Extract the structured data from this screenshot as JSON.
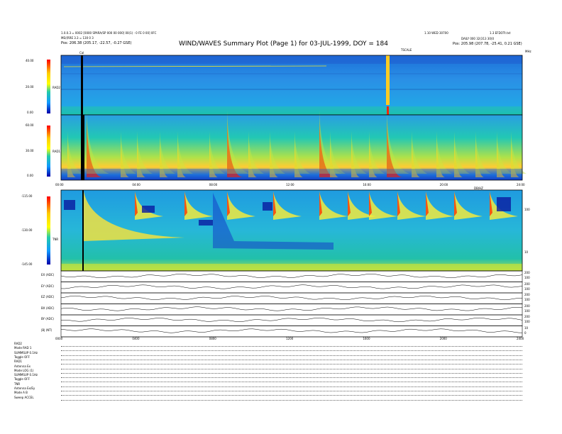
{
  "header": {
    "left_line1": "1.0.0.3 = 0002 [0000 SPARA/SP 000 00 000] 00(1) - 0 FE 0 00] 0FC",
    "left_line2": "ME/(RRE 3.3 = 130 0 3",
    "left_line3": "Pos:  206.38 (205.17, -22.57, -0.27 GSE)",
    "title": "WIND/WAVES Summary Plot (Page 1) for 03-JUL-1999, DOY = 184",
    "right_line1": "1.10 WED 30700",
    "right_line1b": "1.3 EFDOTt.txt",
    "right_line2": "DAILY 000 32(313 30)0",
    "right_line3": "Pos:  205.98 (207.78, -25.41, 0.21 GSE)",
    "ncel_label": "Cal",
    "tscale_label": "TSCALE",
    "mhz_label": "MHz"
  },
  "panels": {
    "rad2": {
      "label": "RAD2",
      "ticks": [
        "40.00",
        "20.00",
        "0.00"
      ]
    },
    "rad1": {
      "label": "RAD1",
      "ticks": [
        "60.00",
        "30.00",
        "0.00"
      ]
    },
    "tnr": {
      "label": "TNR",
      "ticks": [
        "-115.00",
        "-130.00",
        "-145.00"
      ],
      "right_ticks": [
        "100",
        "10"
      ],
      "corner": "DB/HZ"
    }
  },
  "mid_time_axis": [
    "00:00",
    "04:00",
    "08:00",
    "12:00",
    "16:00",
    "20:00",
    "24:00"
  ],
  "bottom_time_axis": [
    "0000",
    "0400",
    "0800",
    "1200",
    "1600",
    "2000",
    "2400"
  ],
  "line_panels": [
    {
      "label": "EX (ADC)",
      "right": [
        "200",
        "100"
      ]
    },
    {
      "label": "EY (ADC)",
      "right": [
        "200",
        "100"
      ]
    },
    {
      "label": "EZ (ADC)",
      "right": [
        "200",
        "100"
      ]
    },
    {
      "label": "BX (ADC)",
      "right": [
        "200",
        "100"
      ]
    },
    {
      "label": "BY (ADC)",
      "right": [
        "200",
        "100"
      ]
    },
    {
      "label": "|B| (NT)",
      "right": [
        "10",
        "0"
      ]
    }
  ],
  "footer": [
    "RAD2",
    "Mode      RAD 1",
    "SUMMSUP  0.1Hz",
    "Toggle     OFF",
    "RAD1",
    "Antenna     Ex",
    "Mode   LOG (1)",
    "SUMMSUP  0.1Hz",
    "Toggle     OFF",
    "TNR",
    "Antenna    Ex/Ey",
    "Mode         A B",
    "Sweep   ACCEL"
  ],
  "colors": {
    "axis": "#000000",
    "background": "#ffffff"
  },
  "chart_data": [
    {
      "type": "heatmap",
      "title": "RAD2",
      "ylim": [
        0,
        40
      ],
      "yunit": "MHz",
      "x_range": [
        "00:00",
        "24:00"
      ],
      "colorscale": "intensity"
    },
    {
      "type": "heatmap",
      "title": "RAD1",
      "ylim": [
        0,
        60
      ],
      "x_range": [
        "00:00",
        "24:00"
      ],
      "colorscale": "intensity"
    },
    {
      "type": "heatmap",
      "title": "TNR",
      "ylim_color": [
        -145,
        -115
      ],
      "x_range": [
        "00:00",
        "24:00"
      ],
      "yscale": "log",
      "colorscale": "dB/Hz"
    }
  ]
}
